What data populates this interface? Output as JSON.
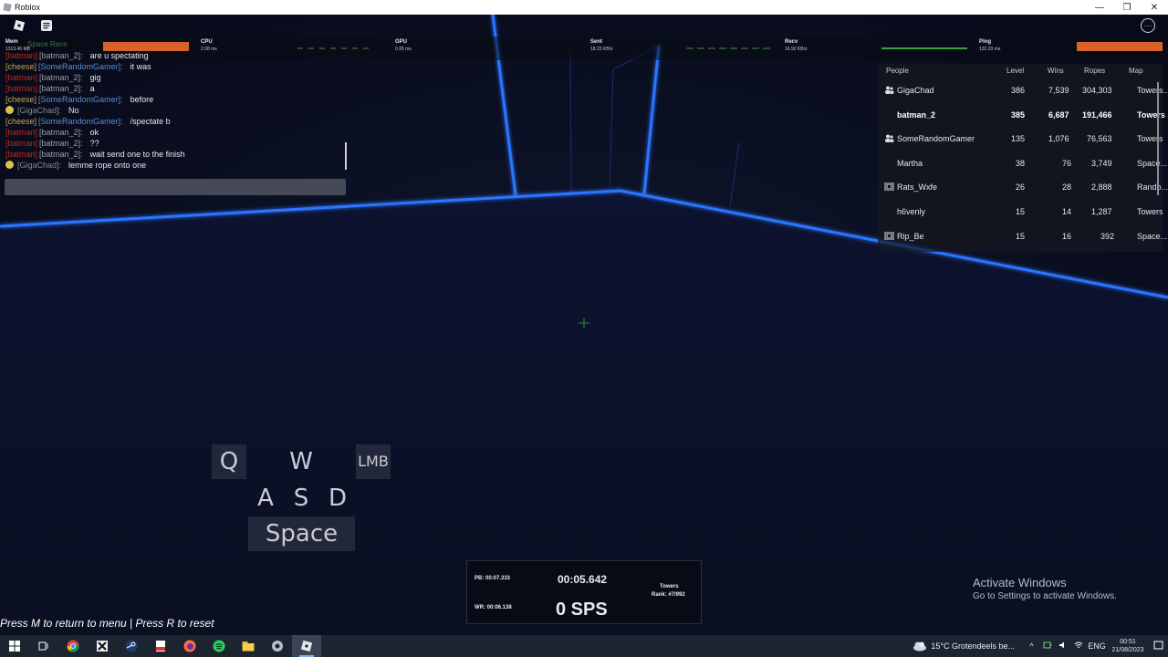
{
  "window": {
    "title": "Roblox",
    "minimize": "—",
    "restore": "❐",
    "close": "✕"
  },
  "topbar": {
    "menu_icon": "roblox-logo-icon",
    "chat_icon": "chat-icon",
    "more": "···"
  },
  "stats": {
    "mem": {
      "label": "Mem",
      "value": "1313.46 MB"
    },
    "cpu": {
      "label": "CPU",
      "value": "2.08 ms"
    },
    "gpu": {
      "label": "GPU",
      "value": "0.95 ms"
    },
    "sent": {
      "label": "Sent",
      "value": "18.23 KB/s"
    },
    "recv": {
      "label": "Recv",
      "value": "16.92 KB/s"
    },
    "ping": {
      "label": "Ping",
      "value": "132.03 ms"
    },
    "game_label": "Space Race"
  },
  "chat": {
    "messages": [
      {
        "tag": "[batman]",
        "name": "[batman_2]:",
        "text": "are u spectating",
        "tag_color": "red"
      },
      {
        "tag": "[cheese]",
        "name": "[SomeRandomGamer]:",
        "text": "it was",
        "tag_color": "gold"
      },
      {
        "tag": "[batman]",
        "name": "[batman_2]:",
        "text": "gig",
        "tag_color": "red"
      },
      {
        "tag": "[batman]",
        "name": "[batman_2]:",
        "text": "a",
        "tag_color": "red"
      },
      {
        "tag": "[cheese]",
        "name": "[SomeRandomGamer]:",
        "text": "before",
        "tag_color": "gold"
      },
      {
        "tag": "",
        "name": "[GigaChad]:",
        "text": "No",
        "tag_color": "emoji"
      },
      {
        "tag": "[cheese]",
        "name": "[SomeRandomGamer]:",
        "text": "/spectate b",
        "tag_color": "gold"
      },
      {
        "tag": "[batman]",
        "name": "[batman_2]:",
        "text": "ok",
        "tag_color": "red"
      },
      {
        "tag": "[batman]",
        "name": "[batman_2]:",
        "text": "??",
        "tag_color": "red"
      },
      {
        "tag": "[batman]",
        "name": "[batman_2]:",
        "text": "wait send one to the finish",
        "tag_color": "red"
      },
      {
        "tag": "",
        "name": "[GigaChad]:",
        "text": "lemme rope onto one",
        "tag_color": "emoji"
      }
    ]
  },
  "leaderboard": {
    "headers": {
      "people": "People",
      "level": "Level",
      "wins": "Wins",
      "ropes": "Ropes",
      "map": "Map"
    },
    "rows": [
      {
        "name": "GigaChad",
        "level": "386",
        "wins": "7,539",
        "ropes": "304,303",
        "map": "Towers...",
        "icon": "friends"
      },
      {
        "name": "batman_2",
        "level": "385",
        "wins": "6,687",
        "ropes": "191,466",
        "map": "Towers",
        "icon": "none"
      },
      {
        "name": "SomeRandomGamer",
        "level": "135",
        "wins": "1,076",
        "ropes": "76,563",
        "map": "Towers",
        "icon": "friends"
      },
      {
        "name": "Martha",
        "level": "38",
        "wins": "76",
        "ropes": "3,749",
        "map": "Space...",
        "icon": "none"
      },
      {
        "name": "Rats_Wxfe",
        "level": "26",
        "wins": "28",
        "ropes": "2,888",
        "map": "Rando...",
        "icon": "premium"
      },
      {
        "name": "h6venly",
        "level": "15",
        "wins": "14",
        "ropes": "1,287",
        "map": "Towers",
        "icon": "none"
      },
      {
        "name": "Rip_Be",
        "level": "15",
        "wins": "16",
        "ropes": "392",
        "map": "Space...",
        "icon": "premium"
      }
    ]
  },
  "keys": {
    "q": "Q",
    "w": "W",
    "lmb": "LMB",
    "a": "A",
    "s": "S",
    "d": "D",
    "space": "Space"
  },
  "timer": {
    "pb": "PB: 00:07.333",
    "wr": "WR: 00:06.138",
    "time": "00:05.642",
    "sps": "0 SPS",
    "map": "Towers",
    "rank": "Rank: #7/992"
  },
  "hint": "Press M to return to menu | Press R to reset",
  "activate": {
    "title": "Activate Windows",
    "subtitle": "Go to Settings to activate Windows."
  },
  "taskbar": {
    "weather": "15°C  Grotendeels be...",
    "lang": "ENG",
    "time": "00:51",
    "date": "21/08/2023"
  },
  "colors": {
    "neon": "#1f6bff",
    "orange": "#d8622a",
    "taskbar": "#1c2430"
  }
}
